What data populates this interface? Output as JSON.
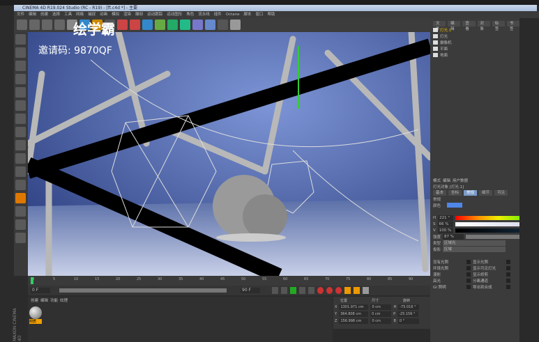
{
  "window": {
    "title": "CINEMA 4D R19.024 Studio (RC - R19) - [ft.c4d *] - 主要"
  },
  "menu": [
    "文件",
    "编辑",
    "创建",
    "选择",
    "工具",
    "网格",
    "捕捉",
    "动画",
    "模拟",
    "渲染",
    "雕刻",
    "运动跟踪",
    "运动图形",
    "角色",
    "流水线",
    "插件",
    "Octane",
    "脚本",
    "窗口",
    "帮助"
  ],
  "watermark": {
    "brand": "绘学霸",
    "invite": "邀请码: 9870QF"
  },
  "object_manager": {
    "tabs": [
      "文件",
      "编辑",
      "查看",
      "对象",
      "标签",
      "书签"
    ],
    "objects": [
      "灯光.1",
      "灯光",
      "摄像机",
      "平面",
      "地面"
    ]
  },
  "attributes": {
    "modes": [
      "模式",
      "编辑",
      "用户数据"
    ],
    "header": "灯光对象 [灯光.1]",
    "tabs": [
      "基本",
      "坐标",
      "常规",
      "细节",
      "可见"
    ],
    "section": "常规",
    "color_label": "颜色",
    "color": "#4f86e8",
    "h": "221 °",
    "s": "66 %",
    "v": "100 %",
    "intensity_label": "强度",
    "intensity": "87 %",
    "type_label": "类型",
    "type": "区域光",
    "shadow_label": "投影",
    "shadow": "区域",
    "checks": [
      [
        "没有光照",
        "显示光照"
      ],
      [
        "环境光照",
        "显示可见灯光"
      ],
      [
        "漫射",
        "显示修剪"
      ],
      [
        "高光",
        "分离通道"
      ],
      [
        "GI 照明",
        "导出到合成"
      ]
    ]
  },
  "timeline": {
    "ticks": [
      "0",
      "5",
      "10",
      "15",
      "20",
      "25",
      "30",
      "35",
      "40",
      "45",
      "50",
      "55",
      "60",
      "65",
      "70",
      "75",
      "80",
      "85",
      "90"
    ],
    "start": "0 F",
    "end": "90 F",
    "current": "0 F",
    "range_end": "90 F"
  },
  "materials": {
    "menu": [
      "创建",
      "编辑",
      "功能",
      "纹理"
    ],
    "items": [
      "材质"
    ]
  },
  "coordinates": {
    "headers": [
      "位置",
      "尺寸",
      "旋转"
    ],
    "rows": [
      [
        "X",
        "1301.971 cm",
        "0 cm",
        "H",
        "-75.016 °"
      ],
      [
        "Y",
        "364.808 cm",
        "0 cm",
        "P",
        "-25.156 °"
      ],
      [
        "Z",
        "156.998 cm",
        "0 cm",
        "B",
        "0 °"
      ]
    ]
  },
  "logo": "MAXON CINEMA 4D"
}
